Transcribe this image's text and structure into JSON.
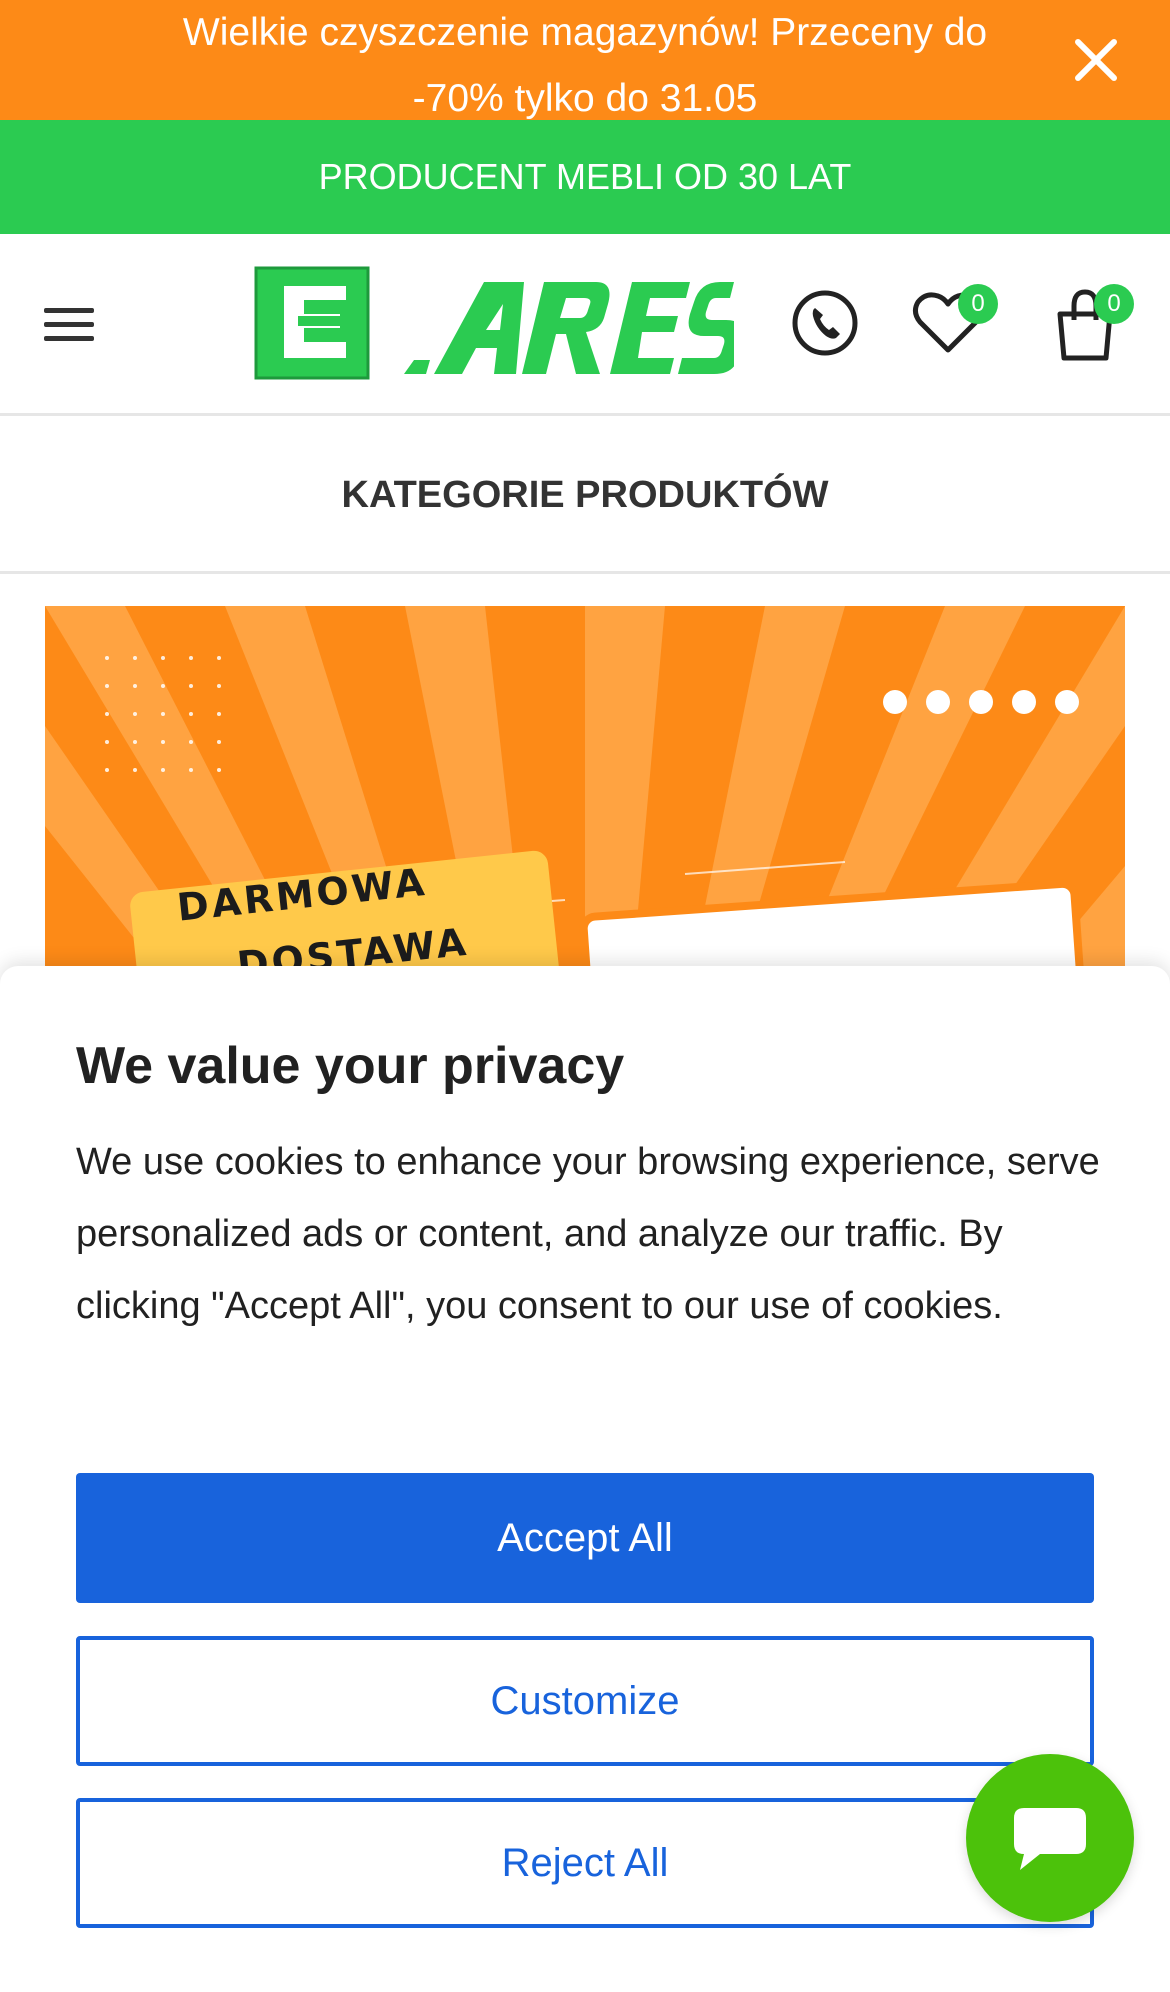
{
  "promo": {
    "line1": "Wielkie czyszczenie magazynów! Przeceny do",
    "line2": "-70% tylko do 31.05",
    "close_icon": "close-icon"
  },
  "tagline": "PRODUCENT MEBLI OD 30 LAT",
  "header": {
    "menu_icon": "hamburger-menu-icon",
    "logo_text": "ARES",
    "phone_icon": "phone-icon",
    "wishlist_icon": "heart-icon",
    "wishlist_count": "0",
    "cart_icon": "shopping-bag-icon",
    "cart_count": "0"
  },
  "categories_label": "KATEGORIE PRODUKTÓW",
  "banner": {
    "sign_line1": "DARMOWA",
    "sign_line2": "DOSTAWA",
    "slide_dots": 5
  },
  "cookie": {
    "title": "We value your privacy",
    "text": "We use cookies to enhance your browsing experience, serve personalized ads or content, and analyze our traffic. By clicking \"Accept All\", you consent to our use of cookies.",
    "accept_label": "Accept All",
    "customize_label": "Customize",
    "reject_label": "Reject All"
  },
  "chat_icon": "chat-bubble-icon",
  "colors": {
    "promo": "#fd8a17",
    "green": "#2bcb51",
    "primary_button": "#1863dc",
    "chat": "#4cc20b"
  }
}
